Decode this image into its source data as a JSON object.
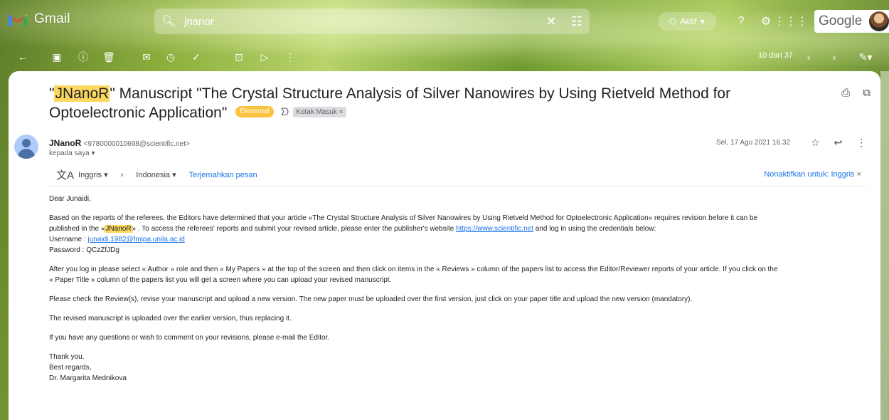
{
  "header": {
    "app_name": "Gmail",
    "search_value": "jnanor",
    "status_label": "Aktif",
    "brand": "Google"
  },
  "toolbar": {
    "pager": "10 dari 37"
  },
  "email": {
    "subject_pre": "\"",
    "subject_hl": "JNanoR",
    "subject_rest": "\" Manuscript \"The Crystal Structure Analysis of Silver Nanowires by Using Rietveld Method for Optoelectronic Application\"",
    "badge": "Eksternal",
    "label": "Kotak Masuk ×",
    "sender_name": "JNanoR",
    "sender_email": "<9780000010698@scientific.net>",
    "to": "kepada saya",
    "date": "Sel, 17 Agu 2021 16.32"
  },
  "translate": {
    "from_lang": "Inggris",
    "to_lang": "Indonesia",
    "translate_link": "Terjemahkan pesan",
    "disable": "Nonaktifkan untuk: Inggris"
  },
  "body": {
    "greeting": "Dear  Junaidi,",
    "p1a": "Based on the reports of the referees, the Editors have determined that your article «The Crystal Structure Analysis of Silver Nanowires by Using Rietveld Method for Optoelectronic Application» requires revision before it can be",
    "p1b_pre": "published in the «",
    "p1b_hl": "JNanoR",
    "p1b_post": "» . To access the referees' reports and submit your revised article, please enter the publisher's website ",
    "website": "https://www.scientific.net",
    "p1b_end": " and log in using the credentials below:",
    "username_label": "Username : ",
    "username": "junaidi.1982@fmipa.unila.ac.id",
    "password_line": "Password : QCzZfJDg",
    "p2a": "After you log in please select « Author » role and then « My Papers » at the top of the screen and then click on items in the « Reviews » column of the papers list to access the Editor/Reviewer reports of your article. If you click on the",
    "p2b": "« Paper Title » column of the papers list you will get a screen where you can upload your revised manuscript.",
    "p3": "Please check the Review(s), revise your manuscript and upload a new version. The new paper must be uploaded over the first version, just click on your paper title and upload the new version (mandatory).",
    "p4": "The revised manuscript is uploaded over the earlier version, thus replacing it.",
    "p5": "If you have any questions or wish to comment on your revisions, please e-mail the Editor.",
    "thanks": "Thank you.",
    "regards": "Best regards,",
    "signature": "Dr. Margarita Mednikova"
  }
}
